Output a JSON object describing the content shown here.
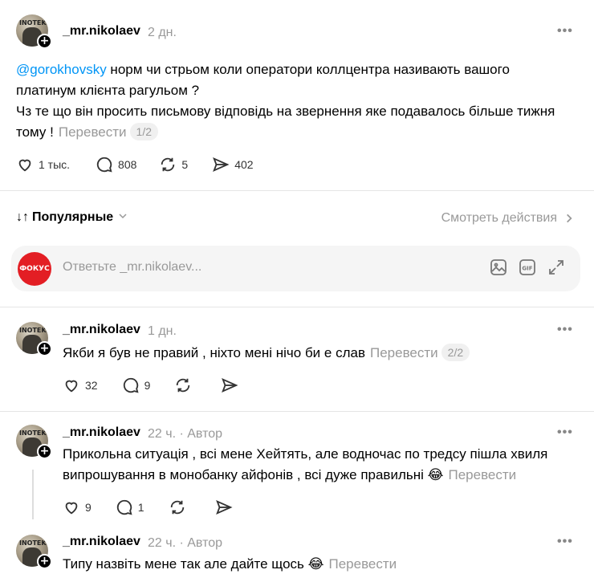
{
  "main_post": {
    "username": "_mr.nikolaev",
    "time": "2 дн.",
    "mention": "@gorokhovsky",
    "line1_after_mention": " норм чи стрьом коли оператори коллцентра називають вашого",
    "line2": "платинум клієнта рагульом ?",
    "line3": "Чз те що він просить письмову відповідь на звернення яке подавалось більше тижня",
    "line4": "тому !",
    "translate": "Перевести",
    "pager": "1/2",
    "likes": "1 тыс.",
    "comments": "808",
    "reposts": "5",
    "shares": "402"
  },
  "sort": {
    "label": "Популярные",
    "activity": "Смотреть действия"
  },
  "reply_box": {
    "logo_text": "ФОКУС",
    "placeholder": "Ответьте _mr.nikolaev..."
  },
  "replies": [
    {
      "username": "_mr.nikolaev",
      "time": "1 дн.",
      "author": "",
      "text": "Якби я був не правий , ніхто мені нічо би е слав",
      "translate": "Перевести",
      "pager": "2/2",
      "likes": "32",
      "comments": "9"
    },
    {
      "username": "_mr.nikolaev",
      "time": "22 ч.",
      "author": "Автор",
      "text_line1": "Прикольна ситуація , всі мене Хейтять, але водночас по тредсу пішла хвиля",
      "text_line2": "випрошування в монобанку айфонів , всі дуже правильні 😂",
      "translate": "Перевести",
      "likes": "9",
      "comments": "1"
    },
    {
      "username": "_mr.nikolaev",
      "time": "22 ч.",
      "author": "Автор",
      "text": "Типу назвіть мене так але дайте щось 😂",
      "translate": "Перевести"
    }
  ],
  "avatar_text": "INOTEK",
  "colors": {
    "mention": "#0095f6",
    "muted": "#999999",
    "logo_red": "#e31e24"
  }
}
